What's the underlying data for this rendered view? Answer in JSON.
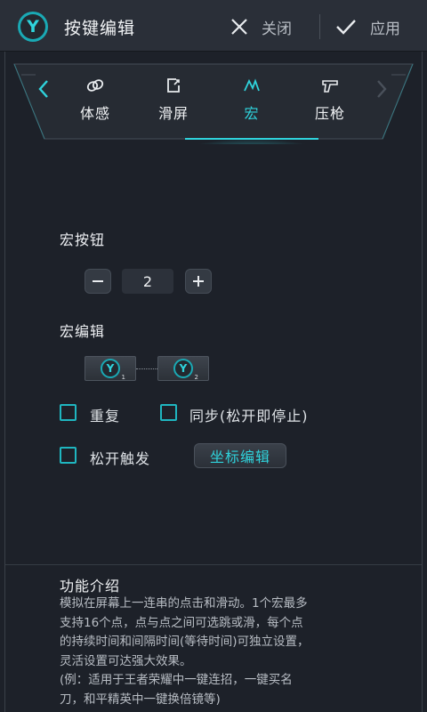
{
  "header": {
    "logo_letter": "Y",
    "title": "按键编辑",
    "close_label": "关闭",
    "apply_label": "应用"
  },
  "tabs": {
    "items": [
      {
        "label": "体感",
        "icon": "link-icon"
      },
      {
        "label": "滑屏",
        "icon": "swipe-icon"
      },
      {
        "label": "宏",
        "icon": "macro-icon"
      },
      {
        "label": "压枪",
        "icon": "gun-icon"
      }
    ],
    "active_index": 2
  },
  "macro_button": {
    "label": "宏按钮",
    "value": "2",
    "minus": "−",
    "plus": "+"
  },
  "macro_edit": {
    "label": "宏编辑",
    "nodes": [
      {
        "letter": "Y",
        "num": "1"
      },
      {
        "letter": "Y",
        "num": "2"
      }
    ]
  },
  "options": {
    "repeat": "重复",
    "sync": "同步(松开即停止)",
    "release_trigger": "松开触发",
    "coord_edit": "坐标编辑"
  },
  "intro": {
    "title": "功能介绍",
    "lines": [
      "模拟在屏幕上一连串的点击和滑动。1个宏最多",
      "支持16个点，点与点之间可选跳或滑，每个点",
      "的持续时间和间隔时间(等待时间)可独立设置，",
      "灵活设置可达强大效果。",
      "(例：适用于王者荣耀中一键连招，一键买名",
      "刀，和平精英中一键换倍镜等)"
    ]
  },
  "colors": {
    "accent": "#2fd3dc",
    "background": "#1d2129",
    "header": "#2a2f38"
  }
}
